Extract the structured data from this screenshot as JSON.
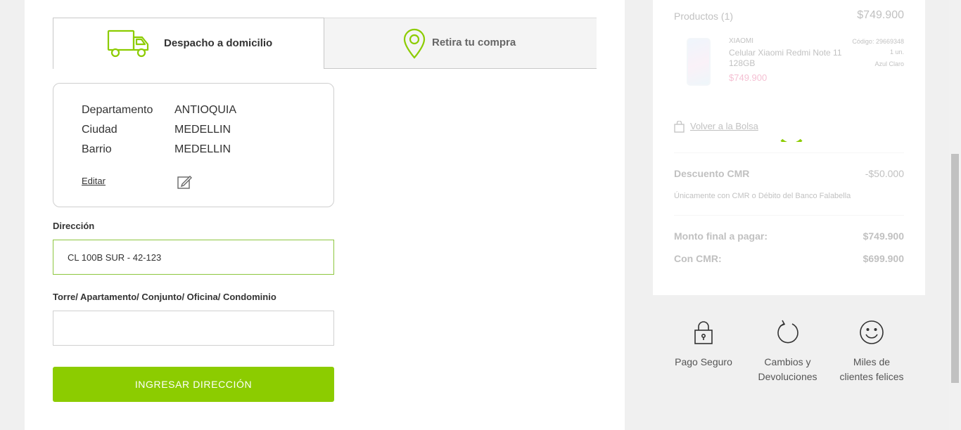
{
  "delivery_tabs": [
    {
      "label": "Despacho a domicilio",
      "icon": "truck-icon",
      "active": true
    },
    {
      "label": "Retira tu compra",
      "icon": "location-pin-icon",
      "active": false
    }
  ],
  "location": {
    "rows": [
      {
        "key": "Departamento",
        "value": "ANTIOQUIA"
      },
      {
        "key": "Ciudad",
        "value": "MEDELLIN"
      },
      {
        "key": "Barrio",
        "value": "MEDELLIN"
      }
    ],
    "edit_label": "Editar",
    "edit_icon": "edit-pencil-icon"
  },
  "form": {
    "address_label": "Dirección",
    "address_value": "CL 100B SUR - 42-123",
    "unit_label": "Torre/ Apartamento/ Conjunto/ Oficina/ Condominio",
    "unit_value": "",
    "submit_label": "INGRESAR DIRECCIÓN"
  },
  "summary": {
    "products_label": "Productos (1)",
    "products_total": "$749.900",
    "item": {
      "brand": "XIAOMI",
      "name": "Celular Xiaomi Redmi Note 11 128GB",
      "price": "$749.900",
      "code": "Código: 29669348",
      "qty": "1 un.",
      "color": "Azul Claro"
    },
    "back_label": "Volver a la Bolsa",
    "discount_label": "Descuento CMR",
    "discount_value": "-$50.000",
    "discount_note": "Únicamente con CMR o Débito del Banco Falabella",
    "final_label": "Monto final a pagar:",
    "final_value": "$749.900",
    "cmr_label": "Con CMR:",
    "cmr_value": "$699.900"
  },
  "features": [
    {
      "icon": "padlock-icon",
      "line1": "Pago Seguro",
      "line2": ""
    },
    {
      "icon": "return-arrow-icon",
      "line1": "Cambios y",
      "line2": "Devoluciones"
    },
    {
      "icon": "smiley-icon",
      "line1": "Miles de",
      "line2": "clientes felices"
    }
  ],
  "colors": {
    "accent": "#8ccc00",
    "sale_price": "#e0407a",
    "focus_border": "#8dc63f"
  }
}
